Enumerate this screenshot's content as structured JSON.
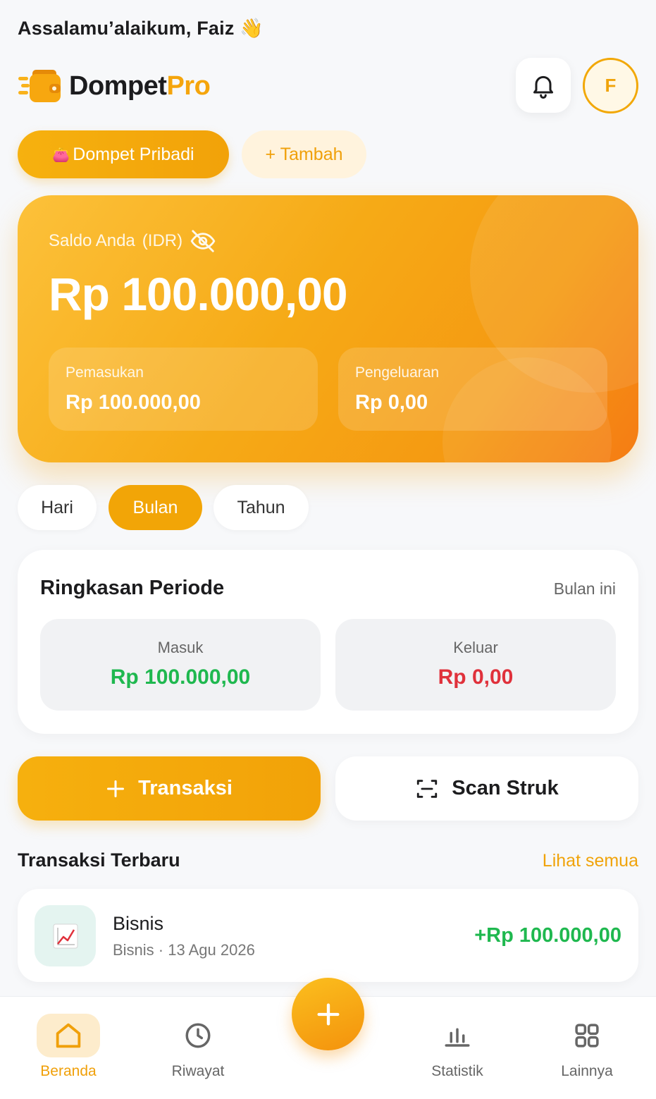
{
  "header": {
    "greeting": "Assalamu’alaikum, Faiz",
    "wave_emoji": "👋",
    "logo_text_dark": "Dompet",
    "logo_text_accent": "Pro",
    "avatar_initial": "F"
  },
  "wallet_tabs": {
    "active_emoji": "👛",
    "active_label": "Dompet Pribadi",
    "add_label": "+ Tambah"
  },
  "balance_card": {
    "label": "Saldo Anda",
    "currency": "(IDR)",
    "value": "Rp 100.000,00",
    "income_label": "Pemasukan",
    "income_value": "Rp 100.000,00",
    "expense_label": "Pengeluaran",
    "expense_value": "Rp 0,00"
  },
  "period_tabs": {
    "day": "Hari",
    "month": "Bulan",
    "year": "Tahun",
    "selected": "Bulan"
  },
  "summary": {
    "title": "Ringkasan Periode",
    "period": "Bulan ini",
    "in_label": "Masuk",
    "in_value": "Rp 100.000,00",
    "out_label": "Keluar",
    "out_value": "Rp 0,00"
  },
  "actions": {
    "add_transaction": "Transaksi",
    "scan_receipt": "Scan Struk"
  },
  "recent": {
    "title": "Transaksi Terbaru",
    "see_all": "Lihat semua",
    "items": [
      {
        "icon": "chart-up-icon",
        "name": "Bisnis",
        "meta": "Bisnis · 13 Agu 2026",
        "amount": "+Rp 100.000,00"
      }
    ]
  },
  "bottom_nav": {
    "home": "Beranda",
    "history": "Riwayat",
    "stats": "Statistik",
    "more": "Lainnya",
    "active": "Beranda"
  },
  "colors": {
    "accent": "#f2a507",
    "positive": "#1fb84f",
    "negative": "#e0313b",
    "background": "#f7f8fa"
  }
}
